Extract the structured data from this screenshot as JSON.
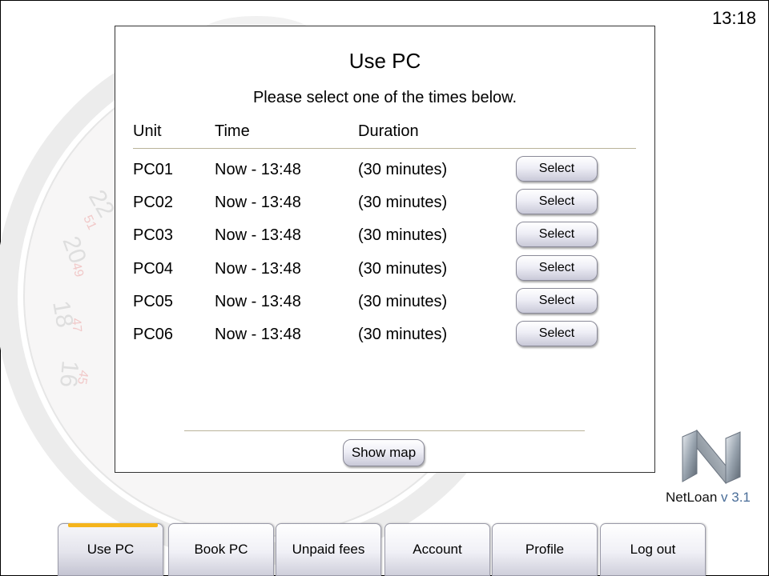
{
  "clock": "13:18",
  "panel": {
    "title": "Use PC",
    "subtitle": "Please select one of the times below.",
    "columns": {
      "unit": "Unit",
      "time": "Time",
      "duration": "Duration"
    },
    "rows": [
      {
        "unit": "PC01",
        "time": "Now - 13:48",
        "duration": "(30 minutes)",
        "action": "Select"
      },
      {
        "unit": "PC02",
        "time": "Now - 13:48",
        "duration": "(30 minutes)",
        "action": "Select"
      },
      {
        "unit": "PC03",
        "time": "Now - 13:48",
        "duration": "(30 minutes)",
        "action": "Select"
      },
      {
        "unit": "PC04",
        "time": "Now - 13:48",
        "duration": "(30 minutes)",
        "action": "Select"
      },
      {
        "unit": "PC05",
        "time": "Now - 13:48",
        "duration": "(30 minutes)",
        "action": "Select"
      },
      {
        "unit": "PC06",
        "time": "Now - 13:48",
        "duration": "(30 minutes)",
        "action": "Select"
      }
    ],
    "show_map_label": "Show map"
  },
  "brand": {
    "name": "NetLoan",
    "version": "v 3.1"
  },
  "tabs": [
    {
      "label": "Use PC",
      "active": true
    },
    {
      "label": "Book PC"
    },
    {
      "label": "Unpaid fees"
    },
    {
      "label": "Account"
    },
    {
      "label": "Profile"
    },
    {
      "label": "Log out"
    }
  ],
  "colors": {
    "active_tab_accent": "#f5b41c",
    "version_text": "#4a6e99"
  },
  "icons": {
    "logo": "netloan-n-logo"
  }
}
